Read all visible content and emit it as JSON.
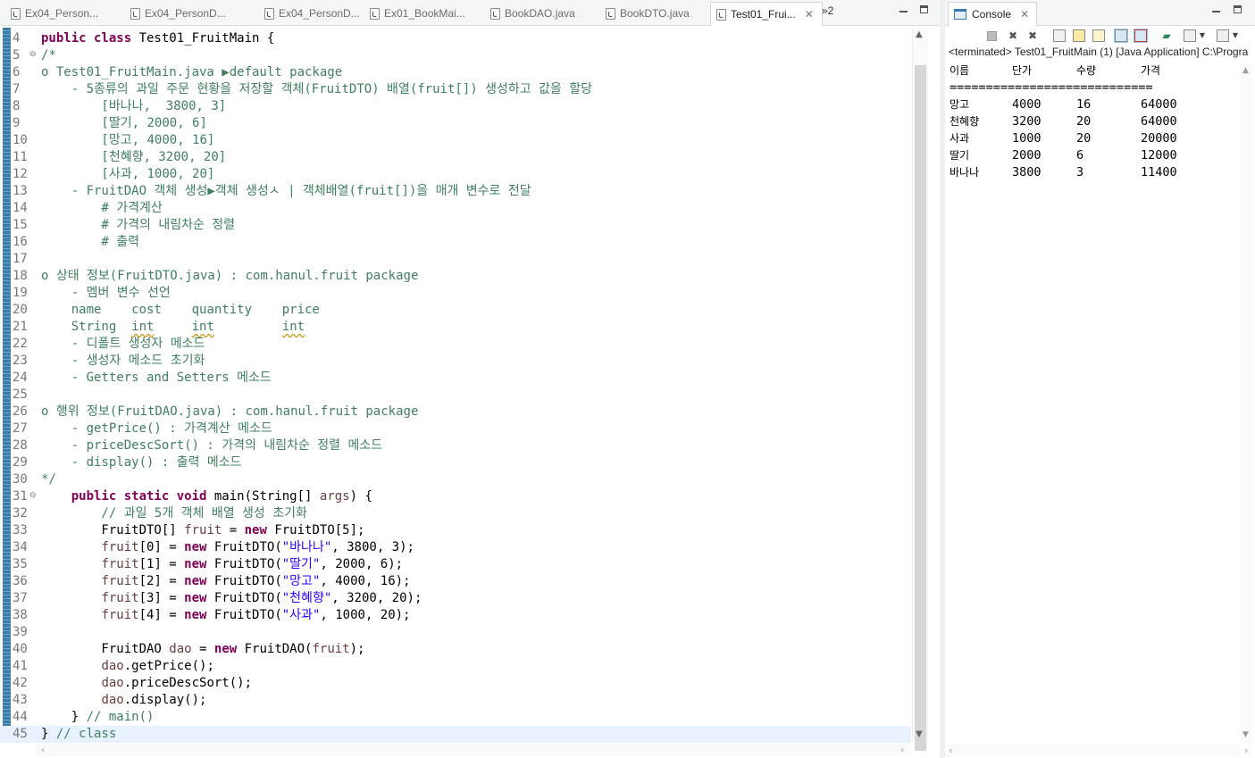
{
  "editor": {
    "tabs": [
      {
        "label": "Ex04_Person...",
        "active": false
      },
      {
        "label": "Ex04_PersonD...",
        "active": false
      },
      {
        "label": "Ex04_PersonD...",
        "active": false
      },
      {
        "label": "Ex01_BookMai...",
        "active": false
      },
      {
        "label": "BookDAO.java",
        "active": false
      },
      {
        "label": "BookDTO.java",
        "active": false
      },
      {
        "label": "Test01_Frui...",
        "active": true
      }
    ],
    "overflow_label": "»2",
    "close_glyph": "✕",
    "lines": [
      {
        "n": "4",
        "fold": "",
        "segs": [
          {
            "t": "public class ",
            "c": "kw"
          },
          {
            "t": "Test01_FruitMain {",
            "c": ""
          }
        ]
      },
      {
        "n": "5",
        "fold": "⊖",
        "segs": [
          {
            "t": "/*",
            "c": "cm"
          }
        ]
      },
      {
        "n": "6",
        "fold": "",
        "segs": [
          {
            "t": "o Test01_FruitMain.java ▶default package",
            "c": "cm"
          }
        ]
      },
      {
        "n": "7",
        "fold": "",
        "segs": [
          {
            "t": "    - 5종류의 과일 주문 현황을 저장할 객체(FruitDTO) 배열(fruit[]) 생성하고 값을 할당",
            "c": "cm"
          }
        ]
      },
      {
        "n": "8",
        "fold": "",
        "segs": [
          {
            "t": "        [바나나,  3800, 3]",
            "c": "cm"
          }
        ]
      },
      {
        "n": "9",
        "fold": "",
        "segs": [
          {
            "t": "        [딸기, 2000, 6]",
            "c": "cm"
          }
        ]
      },
      {
        "n": "10",
        "fold": "",
        "segs": [
          {
            "t": "        [망고, 4000, 16]",
            "c": "cm"
          }
        ]
      },
      {
        "n": "11",
        "fold": "",
        "segs": [
          {
            "t": "        [천혜향, 3200, 20]",
            "c": "cm"
          }
        ]
      },
      {
        "n": "12",
        "fold": "",
        "segs": [
          {
            "t": "        [사과, 1000, 20]",
            "c": "cm"
          }
        ]
      },
      {
        "n": "13",
        "fold": "",
        "segs": [
          {
            "t": "    - FruitDAO 객체 생성▶객체 생성ㅅ | 객체배열(fruit[])을 매개 변수로 전달",
            "c": "cm"
          }
        ]
      },
      {
        "n": "14",
        "fold": "",
        "segs": [
          {
            "t": "        # 가격계산",
            "c": "cm"
          }
        ]
      },
      {
        "n": "15",
        "fold": "",
        "segs": [
          {
            "t": "        # 가격의 내림차순 정렬",
            "c": "cm"
          }
        ]
      },
      {
        "n": "16",
        "fold": "",
        "segs": [
          {
            "t": "        # 출력",
            "c": "cm"
          }
        ]
      },
      {
        "n": "17",
        "fold": "",
        "segs": []
      },
      {
        "n": "18",
        "fold": "",
        "segs": [
          {
            "t": "o 상태 정보(FruitDTO.java) : com.hanul.fruit package",
            "c": "cm"
          }
        ]
      },
      {
        "n": "19",
        "fold": "",
        "segs": [
          {
            "t": "    - 멤버 변수 선언",
            "c": "cm"
          }
        ]
      },
      {
        "n": "20",
        "fold": "",
        "segs": [
          {
            "t": "    name    cost    quantity    price",
            "c": "cm"
          }
        ]
      },
      {
        "n": "21",
        "fold": "",
        "segs": [
          {
            "t": "    String  ",
            "c": "cm"
          },
          {
            "t": "int",
            "c": "cm warn"
          },
          {
            "t": "     ",
            "c": "cm"
          },
          {
            "t": "int",
            "c": "cm warn"
          },
          {
            "t": "         ",
            "c": "cm"
          },
          {
            "t": "int",
            "c": "cm warn"
          }
        ]
      },
      {
        "n": "22",
        "fold": "",
        "segs": [
          {
            "t": "    - 디폴트 생성자 메소드",
            "c": "cm"
          }
        ]
      },
      {
        "n": "23",
        "fold": "",
        "segs": [
          {
            "t": "    - 생성자 메소드 초기화",
            "c": "cm"
          }
        ]
      },
      {
        "n": "24",
        "fold": "",
        "segs": [
          {
            "t": "    - Getters and Setters 메소드",
            "c": "cm"
          }
        ]
      },
      {
        "n": "25",
        "fold": "",
        "segs": []
      },
      {
        "n": "26",
        "fold": "",
        "segs": [
          {
            "t": "o 행위 정보(FruitDAO.java) : com.hanul.fruit package",
            "c": "cm"
          }
        ]
      },
      {
        "n": "27",
        "fold": "",
        "segs": [
          {
            "t": "    - getPrice() : 가격계산 메소드",
            "c": "cm"
          }
        ]
      },
      {
        "n": "28",
        "fold": "",
        "segs": [
          {
            "t": "    - priceDescSort() : 가격의 내림차순 정렬 메소드",
            "c": "cm"
          }
        ]
      },
      {
        "n": "29",
        "fold": "",
        "segs": [
          {
            "t": "    - display() : 출력 메소드",
            "c": "cm"
          }
        ]
      },
      {
        "n": "30",
        "fold": "",
        "segs": [
          {
            "t": "*/",
            "c": "cm"
          }
        ]
      },
      {
        "n": "31",
        "fold": "⊖",
        "segs": [
          {
            "t": "    ",
            "c": ""
          },
          {
            "t": "public static void ",
            "c": "kw"
          },
          {
            "t": "main(String[] ",
            "c": ""
          },
          {
            "t": "args",
            "c": "vr"
          },
          {
            "t": ") {",
            "c": ""
          }
        ]
      },
      {
        "n": "32",
        "fold": "",
        "segs": [
          {
            "t": "        // 과일 5개 객체 배열 생성 초기화",
            "c": "cm"
          }
        ]
      },
      {
        "n": "33",
        "fold": "",
        "segs": [
          {
            "t": "        FruitDTO[] ",
            "c": ""
          },
          {
            "t": "fruit",
            "c": "vr"
          },
          {
            "t": " = ",
            "c": ""
          },
          {
            "t": "new ",
            "c": "kw"
          },
          {
            "t": "FruitDTO[5];",
            "c": ""
          }
        ]
      },
      {
        "n": "34",
        "fold": "",
        "segs": [
          {
            "t": "        ",
            "c": ""
          },
          {
            "t": "fruit",
            "c": "vr"
          },
          {
            "t": "[0] = ",
            "c": ""
          },
          {
            "t": "new ",
            "c": "kw"
          },
          {
            "t": "FruitDTO(",
            "c": ""
          },
          {
            "t": "\"바나나\"",
            "c": "str"
          },
          {
            "t": ", 3800, 3);",
            "c": ""
          }
        ]
      },
      {
        "n": "35",
        "fold": "",
        "segs": [
          {
            "t": "        ",
            "c": ""
          },
          {
            "t": "fruit",
            "c": "vr"
          },
          {
            "t": "[1] = ",
            "c": ""
          },
          {
            "t": "new ",
            "c": "kw"
          },
          {
            "t": "FruitDTO(",
            "c": ""
          },
          {
            "t": "\"딸기\"",
            "c": "str"
          },
          {
            "t": ", 2000, 6);",
            "c": ""
          }
        ]
      },
      {
        "n": "36",
        "fold": "",
        "segs": [
          {
            "t": "        ",
            "c": ""
          },
          {
            "t": "fruit",
            "c": "vr"
          },
          {
            "t": "[2] = ",
            "c": ""
          },
          {
            "t": "new ",
            "c": "kw"
          },
          {
            "t": "FruitDTO(",
            "c": ""
          },
          {
            "t": "\"망고\"",
            "c": "str"
          },
          {
            "t": ", 4000, 16);",
            "c": ""
          }
        ]
      },
      {
        "n": "37",
        "fold": "",
        "segs": [
          {
            "t": "        ",
            "c": ""
          },
          {
            "t": "fruit",
            "c": "vr"
          },
          {
            "t": "[3] = ",
            "c": ""
          },
          {
            "t": "new ",
            "c": "kw"
          },
          {
            "t": "FruitDTO(",
            "c": ""
          },
          {
            "t": "\"천혜향\"",
            "c": "str"
          },
          {
            "t": ", 3200, 20);",
            "c": ""
          }
        ]
      },
      {
        "n": "38",
        "fold": "",
        "segs": [
          {
            "t": "        ",
            "c": ""
          },
          {
            "t": "fruit",
            "c": "vr"
          },
          {
            "t": "[4] = ",
            "c": ""
          },
          {
            "t": "new ",
            "c": "kw"
          },
          {
            "t": "FruitDTO(",
            "c": ""
          },
          {
            "t": "\"사과\"",
            "c": "str"
          },
          {
            "t": ", 1000, 20);",
            "c": ""
          }
        ]
      },
      {
        "n": "39",
        "fold": "",
        "segs": []
      },
      {
        "n": "40",
        "fold": "",
        "segs": [
          {
            "t": "        FruitDAO ",
            "c": ""
          },
          {
            "t": "dao",
            "c": "vr"
          },
          {
            "t": " = ",
            "c": ""
          },
          {
            "t": "new ",
            "c": "kw"
          },
          {
            "t": "FruitDAO(",
            "c": ""
          },
          {
            "t": "fruit",
            "c": "vr"
          },
          {
            "t": ");",
            "c": ""
          }
        ]
      },
      {
        "n": "41",
        "fold": "",
        "segs": [
          {
            "t": "        ",
            "c": ""
          },
          {
            "t": "dao",
            "c": "vr"
          },
          {
            "t": ".getPrice();",
            "c": ""
          }
        ]
      },
      {
        "n": "42",
        "fold": "",
        "segs": [
          {
            "t": "        ",
            "c": ""
          },
          {
            "t": "dao",
            "c": "vr"
          },
          {
            "t": ".priceDescSort();",
            "c": ""
          }
        ]
      },
      {
        "n": "43",
        "fold": "",
        "segs": [
          {
            "t": "        ",
            "c": ""
          },
          {
            "t": "dao",
            "c": "vr"
          },
          {
            "t": ".display();",
            "c": ""
          }
        ]
      },
      {
        "n": "44",
        "fold": "",
        "segs": [
          {
            "t": "    } ",
            "c": ""
          },
          {
            "t": "// main()",
            "c": "cm"
          }
        ]
      },
      {
        "n": "45",
        "fold": "",
        "hl": true,
        "segs": [
          {
            "t": "} ",
            "c": ""
          },
          {
            "t": "// class",
            "c": "cm"
          }
        ]
      }
    ]
  },
  "console": {
    "tab_label": "Console",
    "close_glyph": "✕",
    "status": "<terminated> Test01_FruitMain (1) [Java Application] C:\\Progra",
    "header": [
      "이름",
      "단가",
      "수량",
      "가격"
    ],
    "separator": "============================",
    "rows": [
      [
        "망고",
        "4000",
        "16",
        "64000"
      ],
      [
        "천혜향",
        "3200",
        "20",
        "64000"
      ],
      [
        "사과",
        "1000",
        "20",
        "20000"
      ],
      [
        "딸기",
        "2000",
        "6",
        "12000"
      ],
      [
        "바나나",
        "3800",
        "3",
        "11400"
      ]
    ]
  },
  "colors": {
    "keyword": "#7f0055",
    "comment": "#3f7f5f",
    "string": "#2a00ff",
    "local_variable": "#6a3e3e",
    "current_line": "#e8f2fe"
  }
}
